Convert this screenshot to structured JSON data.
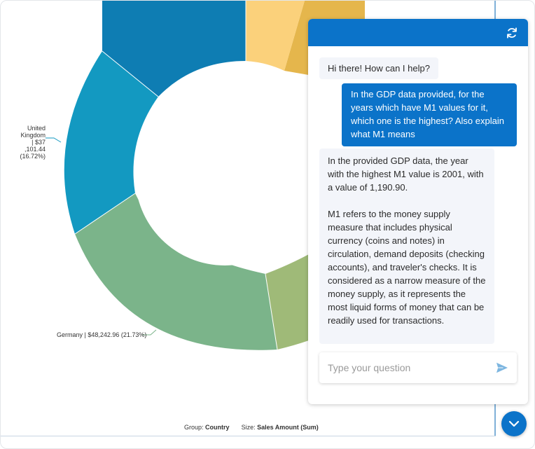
{
  "chart_data": {
    "type": "pie",
    "slices": [
      {
        "label": "United Kingdom | $37,101.44 (16.72%)",
        "share_pct": 16.72,
        "color": "#1399c1"
      },
      {
        "label": "Germany | $48,242.96 (21.73%)",
        "share_pct": 21.73,
        "color": "#7bb48a"
      }
    ],
    "footer": {
      "group_label": "Group:",
      "group_value": "Country",
      "size_label": "Size:",
      "size_value": "Sales Amount (Sum)"
    }
  },
  "labels": {
    "uk": "United Kingdom | $37 ,101.44 (16.72%)",
    "germany": "Germany | $48,242.96 (21.73%)"
  },
  "colors": {
    "accent": "#0b73c9",
    "bot_bubble": "#f3f5fa",
    "slice_dark_blue": "#0e7db3",
    "slice_teal": "#1399c1",
    "slice_green": "#7bb48a",
    "slice_olive": "#9fba78",
    "slice_yellow": "#fbd17b",
    "slice_gold": "#e5b64c"
  },
  "chat": {
    "header_icon": "refresh-icon",
    "messages": [
      {
        "role": "bot",
        "text": "Hi there! How can I help?"
      },
      {
        "role": "user",
        "text": "In the GDP data provided, for the years which have M1 values for it, which one is the highest? Also explain what M1 means"
      },
      {
        "role": "bot",
        "text": "In the provided GDP data, the year with the highest M1 value is 2001, with a value of 1,190.90.\n\nM1 refers to the money supply measure that includes physical currency (coins and notes) in circulation, demand deposits (checking accounts), and traveler's checks. It is considered as a narrow measure of the money supply, as it represents the most liquid forms of money that can be readily used for transactions."
      }
    ],
    "input_placeholder": "Type your question",
    "send_icon": "send-icon",
    "toggle_icon": "chevron-down-icon"
  }
}
